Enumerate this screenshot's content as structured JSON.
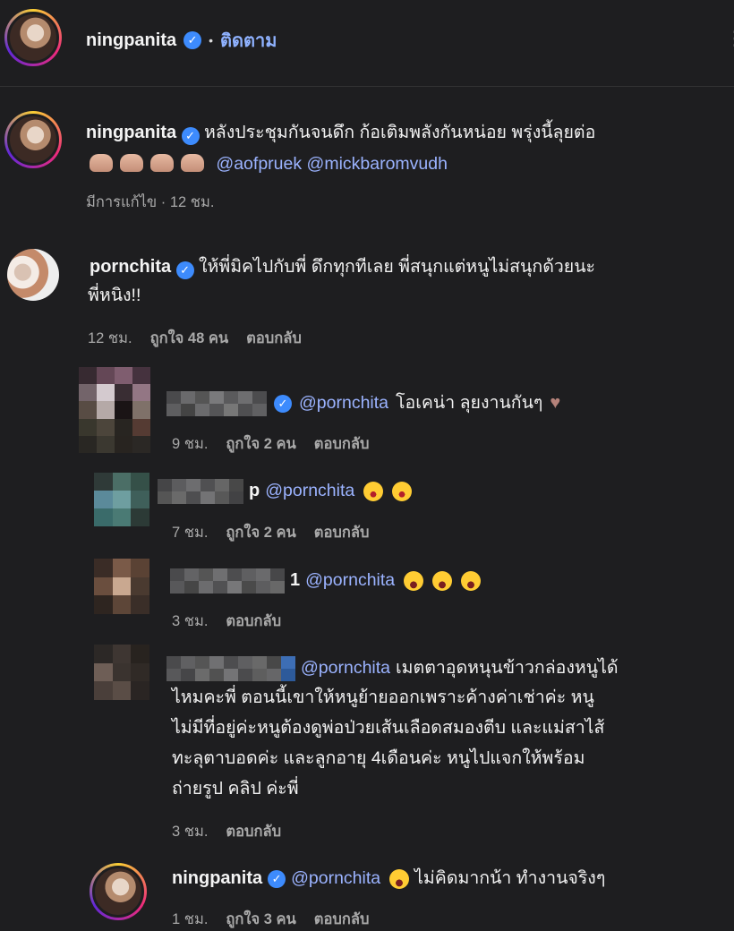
{
  "header": {
    "username": "ningpanita",
    "follow_label": "ติดตาม",
    "dot": "•",
    "more": "⋮"
  },
  "caption": {
    "username": "ningpanita",
    "text": "หลังประชุมกันจนดึก ก้อเติมพลังกันหน่อย พรุ่งนี้ลุยต่อ",
    "mention1": "@aofpruek",
    "mention2": "@mickbaromvudh",
    "meta": "มีการแก้ไข · 12 ชม."
  },
  "comment1": {
    "username": "pornchita",
    "text_line1": "ให้พี่มิคไปกับพี่ ดึกทุกทีเลย พี่สนุกแต่หนูไม่สนุกด้วยนะ",
    "text_line2": "พี่หนิง!!",
    "time": "12 ชม.",
    "likes": "ถูกใจ 48 คน",
    "reply": "ตอบกลับ"
  },
  "reply1": {
    "mention": "@pornchita",
    "text": "โอเคน่า ลุยงานกันๆ",
    "time": "9 ชม.",
    "likes": "ถูกใจ 2 คน",
    "reply": "ตอบกลับ"
  },
  "reply2": {
    "name_suffix": "p",
    "mention": "@pornchita",
    "time": "7 ชม.",
    "likes": "ถูกใจ 2 คน",
    "reply": "ตอบกลับ"
  },
  "reply3": {
    "name_suffix": "1",
    "mention": "@pornchita",
    "time": "3 ชม.",
    "reply": "ตอบกลับ"
  },
  "reply4": {
    "mention": "@pornchita",
    "line1": "เมตตาอุดหนุนข้าวกล่องหนูได้",
    "line2": "ไหมคะพี่ ตอนนี้เขาให้หนูย้ายออกเพราะค้างค่าเช่าค่ะ หนู",
    "line3": "ไม่มีที่อยู่ค่ะหนูต้องดูพ่อป่วยเส้นเลือดสมองตีบ และแม่สาไส้",
    "line4": "ทะลุตาบอดค่ะ และลูกอายุ 4เดือนค่ะ หนูไปแจกให้พร้อม",
    "line5": "ถ่ายรูป คลิป ค่ะพี่",
    "time": "3 ชม.",
    "reply": "ตอบกลับ"
  },
  "reply5": {
    "username": "ningpanita",
    "mention": "@pornchita",
    "text": "ไม่คิดมากน้า ทำงานจริงๆ",
    "time": "1 ชม.",
    "likes": "ถูกใจ 3 คน",
    "reply": "ตอบกลับ"
  },
  "icons": {
    "verified": "✓"
  }
}
